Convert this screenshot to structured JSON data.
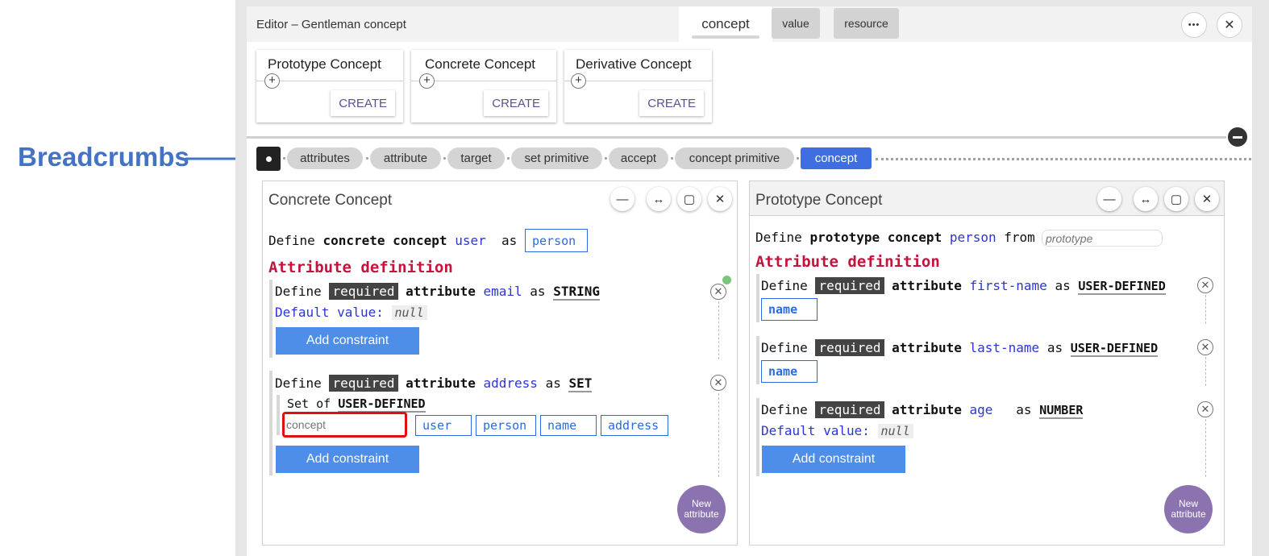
{
  "annotation": {
    "label": "Breadcrumbs"
  },
  "editor": {
    "title": "Editor – Gentleman concept",
    "tabs": [
      "concept",
      "value",
      "resource"
    ],
    "more_label": "•••",
    "close_label": "✕"
  },
  "create_cards": [
    {
      "title": "Prototype Concept",
      "button": "CREATE"
    },
    {
      "title": "Concrete Concept",
      "button": "CREATE"
    },
    {
      "title": "Derivative Concept",
      "button": "CREATE"
    }
  ],
  "breadcrumbs": [
    "attributes",
    "attribute",
    "target",
    "set primitive",
    "accept",
    "concept primitive",
    "concept"
  ],
  "left_pane": {
    "title": "Concrete Concept",
    "def_prefix": "Define",
    "def_kind": "concrete concept",
    "def_name": "user",
    "def_as": "as",
    "def_base": "person",
    "section": "Attribute definition",
    "attr1": {
      "define": "Define",
      "req": "required",
      "attribute": "attribute",
      "name": "email",
      "as": "as",
      "type": "STRING",
      "default_label": "Default value:",
      "default_value": "null",
      "add": "Add constraint"
    },
    "attr2": {
      "define": "Define",
      "req": "required",
      "attribute": "attribute",
      "name": "address",
      "as": "as",
      "type": "SET",
      "set_of": "Set of",
      "set_type": "USER-DEFINED",
      "input_placeholder": "concept",
      "options": [
        "user",
        "person",
        "name",
        "address"
      ],
      "add": "Add constraint"
    },
    "new_attr": "New attribute"
  },
  "right_pane": {
    "title": "Prototype Concept",
    "def_prefix": "Define",
    "def_kind": "prototype concept",
    "def_name": "person",
    "def_from": "from",
    "from_placeholder": "prototype",
    "section": "Attribute definition",
    "attr1": {
      "define": "Define",
      "req": "required",
      "attribute": "attribute",
      "name": "first-name",
      "as": "as",
      "type": "USER-DEFINED",
      "value": "name"
    },
    "attr2": {
      "define": "Define",
      "req": "required",
      "attribute": "attribute",
      "name": "last-name",
      "as": "as",
      "type": "USER-DEFINED",
      "value": "name"
    },
    "attr3": {
      "define": "Define",
      "req": "required",
      "attribute": "attribute",
      "name": "age",
      "as": "as",
      "type": "NUMBER",
      "default_label": "Default value:",
      "default_value": "null",
      "add": "Add constraint"
    },
    "new_attr": "New attribute"
  },
  "pane_icons": {
    "minimize": "—",
    "widen": "↔",
    "maximize": "▢",
    "close": "✕"
  },
  "colors": {
    "accent_blue": "#3e6ee0",
    "keyword_red": "#c2143c",
    "new_attr_purple": "#8b73b0",
    "annotation_blue": "#4472c4",
    "highlight_red": "#e01010"
  }
}
